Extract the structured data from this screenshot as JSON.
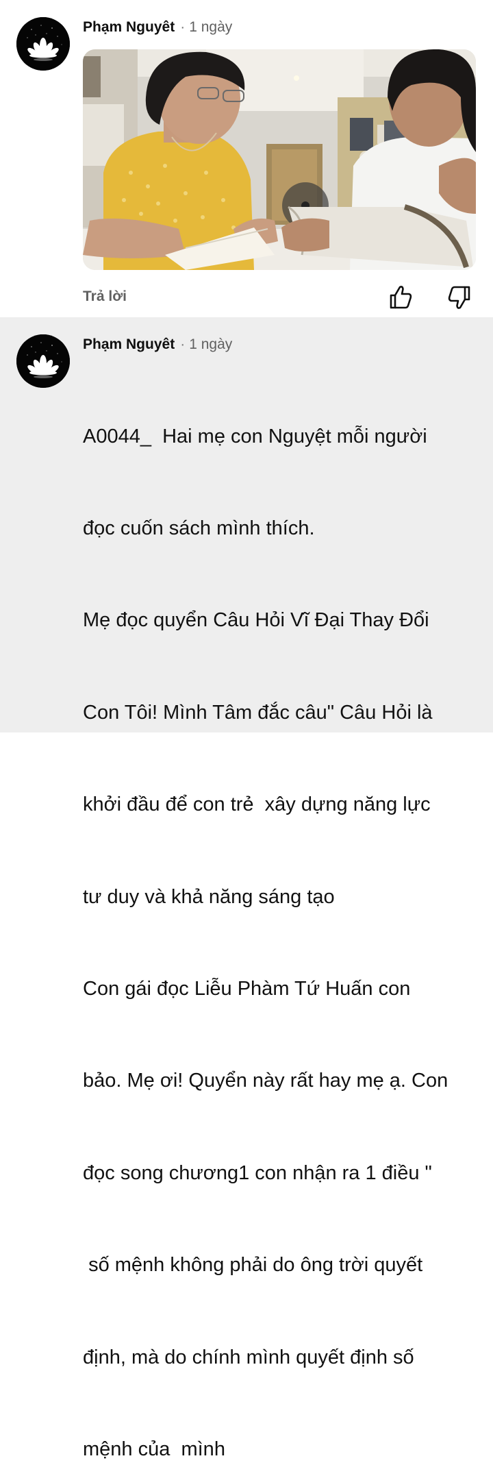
{
  "comments": [
    {
      "author": "Phạm Nguyêt",
      "separator": "·",
      "time": "1 ngày",
      "reply_label": "Trả lời",
      "icons": {
        "like": "thumb-up-icon",
        "dislike": "thumb-down-icon"
      }
    },
    {
      "author": "Phạm Nguyêt",
      "separator": "·",
      "time": "1 ngày",
      "lines": [
        "A0044_  Hai mẹ con Nguyệt mỗi người",
        "đọc cuốn sách mình thích.",
        "Mẹ đọc quyển Câu Hỏi Vĩ Đại Thay Đổi",
        "Con Tôi! Mình Tâm đắc câu\" Câu Hỏi là",
        "khởi đầu để con trẻ  xây dựng năng lực",
        "tư duy và khả năng sáng tạo",
        "Con gái đọc Liễu Phàm Tứ Huấn con",
        "bảo. Mẹ ơi! Quyển này rất hay mẹ ạ. Con",
        "đọc song chương1 con nhận ra 1 điều \"",
        " số mệnh không phải do ông trời quyết",
        "định, mà do chính mình quyết định số",
        "mệnh của  mình"
      ]
    }
  ],
  "colors": {
    "highlight_background": "#eeeeee",
    "secondary_text": "#606060"
  }
}
